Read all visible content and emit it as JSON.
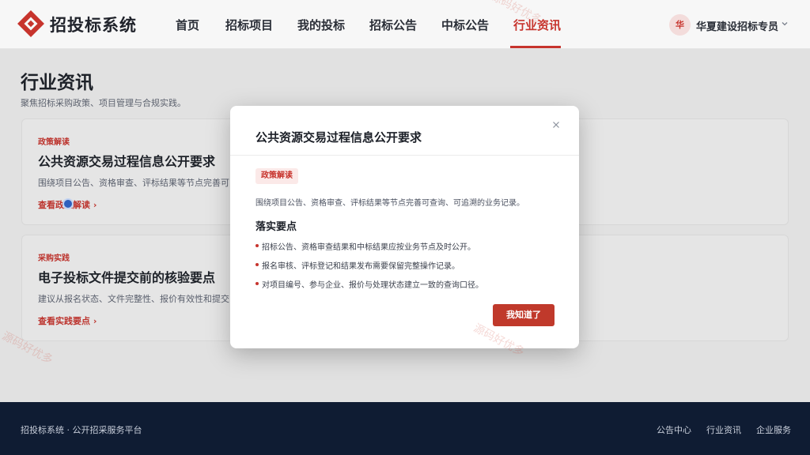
{
  "header": {
    "brand": "招投标系统",
    "nav": [
      {
        "label": "首页"
      },
      {
        "label": "招标项目"
      },
      {
        "label": "我的投标"
      },
      {
        "label": "招标公告"
      },
      {
        "label": "中标公告"
      },
      {
        "label": "行业资讯",
        "active": true
      }
    ],
    "user": {
      "avatar": "华",
      "name": "华夏建设招标专员"
    }
  },
  "page": {
    "title": "行业资讯",
    "subtitle": "聚焦招标采购政策、项目管理与合规实践。",
    "cards": [
      {
        "tag": "政策解读",
        "title": "公共资源交易过程信息公开要求",
        "desc": "围绕项目公告、资格审查、评标结果等节点完善可",
        "link": "查看政策解读"
      },
      {
        "tag": "采购实践",
        "title": "电子投标文件提交前的核验要点",
        "desc": "建议从报名状态、文件完整性、报价有效性和提交",
        "link": "查看实践要点"
      }
    ]
  },
  "modal": {
    "title": "公共资源交易过程信息公开要求",
    "tag": "政策解读",
    "desc": "围绕项目公告、资格审查、评标结果等节点完善可查询、可追溯的业务记录。",
    "section_title": "落实要点",
    "points": [
      "招标公告、资格审查结果和中标结果应按业务节点及时公开。",
      "报名审核、评标登记和结果发布需要保留完整操作记录。",
      "对项目编号、参与企业、报价与处理状态建立一致的查询口径。"
    ],
    "confirm_label": "我知道了"
  },
  "footer": {
    "left": "招投标系统 · 公开招采服务平台",
    "links": [
      "公告中心",
      "行业资讯",
      "企业服务"
    ]
  },
  "watermark": "源码好优多",
  "colors": {
    "accent": "#c7342d",
    "footer_bg": "#0f1c33"
  }
}
